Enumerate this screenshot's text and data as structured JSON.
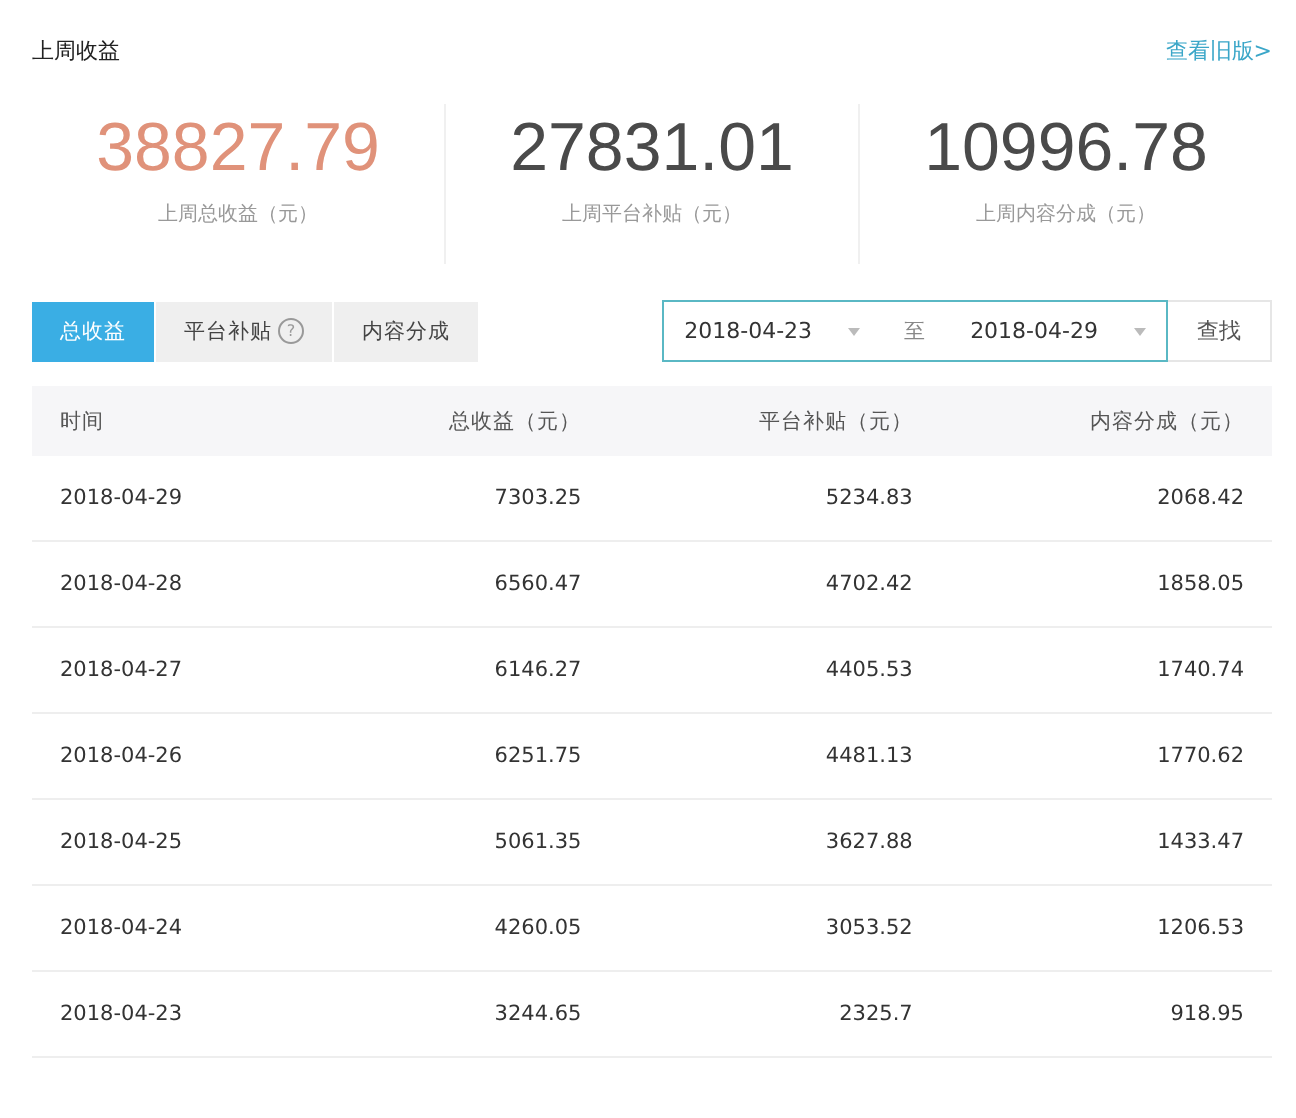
{
  "header": {
    "title": "上周收益",
    "link": "查看旧版>"
  },
  "stats": [
    {
      "value": "38827.79",
      "label": "上周总收益（元）",
      "color": "#e0927a"
    },
    {
      "value": "27831.01",
      "label": "上周平台补贴（元）",
      "color": "#4a4a4a"
    },
    {
      "value": "10996.78",
      "label": "上周内容分成（元）",
      "color": "#4a4a4a"
    }
  ],
  "tabs": [
    {
      "label": "总收益",
      "selected": true
    },
    {
      "label": "平台补贴",
      "selected": false,
      "help_icon": "?"
    },
    {
      "label": "内容分成",
      "selected": false
    }
  ],
  "date_range": {
    "start": "2018-04-23",
    "separator": "至",
    "end": "2018-04-29"
  },
  "search_button": "查找",
  "table": {
    "columns": [
      "时间",
      "总收益（元）",
      "平台补贴（元）",
      "内容分成（元）"
    ],
    "rows": [
      [
        "2018-04-29",
        "7303.25",
        "5234.83",
        "2068.42"
      ],
      [
        "2018-04-28",
        "6560.47",
        "4702.42",
        "1858.05"
      ],
      [
        "2018-04-27",
        "6146.27",
        "4405.53",
        "1740.74"
      ],
      [
        "2018-04-26",
        "6251.75",
        "4481.13",
        "1770.62"
      ],
      [
        "2018-04-25",
        "5061.35",
        "3627.88",
        "1433.47"
      ],
      [
        "2018-04-24",
        "4260.05",
        "3053.52",
        "1206.53"
      ],
      [
        "2018-04-23",
        "3244.65",
        "2325.7",
        "918.95"
      ]
    ]
  }
}
